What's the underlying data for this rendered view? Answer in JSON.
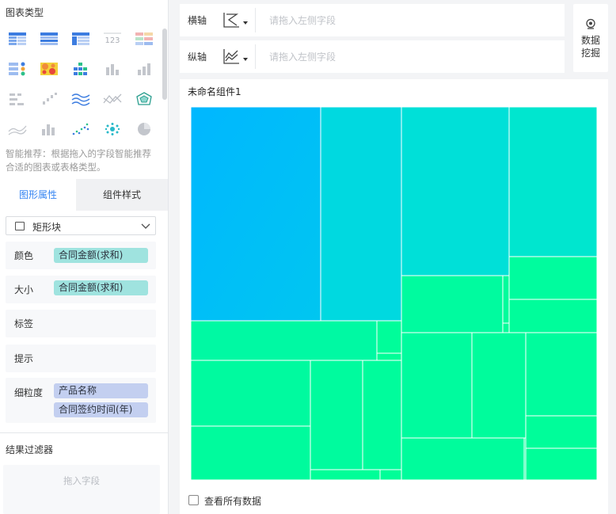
{
  "left_panel": {
    "chart_types_title": "图表类型",
    "chart_type_icons": [
      "grouped-table-icon",
      "detail-table-icon",
      "cross-table-icon",
      "kpi-number-icon",
      "colored-table-icon",
      "dot-matrix-icon",
      "heatmap-icon",
      "stacked-bar-blocks-icon",
      "bar-chart-icon",
      "bar-chart-alt-icon",
      "horizontal-bar-icon",
      "ascending-bar-icon",
      "multi-line-icon",
      "line-cross-icon",
      "radar-icon",
      "area-line-icon",
      "column-chart-icon",
      "scatter-plot-icon",
      "bubble-plot-icon",
      "pie-chart-icon"
    ],
    "smart_tip": "智能推荐：根据拖入的字段智能推荐合适的图表或表格类型。",
    "tabs": {
      "attributes": "图形属性",
      "component_style": "组件样式"
    },
    "mark_type": {
      "icon": "rectangle-icon",
      "label": "矩形块"
    },
    "props": {
      "color": {
        "label": "颜色",
        "field": "合同金额(求和)"
      },
      "size": {
        "label": "大小",
        "field": "合同金额(求和)"
      },
      "label": {
        "label": "标签"
      },
      "tooltip": {
        "label": "提示"
      },
      "granularity": {
        "label": "细粒度",
        "fields": [
          "产品名称",
          "合同签约时间(年)"
        ]
      }
    },
    "result_filter": {
      "title": "结果过滤器",
      "placeholder": "拖入字段"
    }
  },
  "axes": {
    "x": {
      "label": "横轴",
      "icon": "horizontal-axis-icon",
      "placeholder": "请拖入左侧字段"
    },
    "y": {
      "label": "纵轴",
      "icon": "vertical-axis-icon",
      "placeholder": "请拖入左侧字段"
    }
  },
  "data_mining": {
    "label_line1": "数据",
    "label_line2": "挖掘",
    "icon": "data-mining-icon"
  },
  "component": {
    "title": "未命名组件1",
    "view_all_label": "查看所有数据"
  },
  "colors": {
    "accent": "#3685f2",
    "pill_teal": "#9fe3df",
    "pill_blue": "#c3cff0",
    "treemap_high": "#00bff8",
    "treemap_mid": "#00e2d7",
    "treemap_low": "#00ff98"
  }
}
